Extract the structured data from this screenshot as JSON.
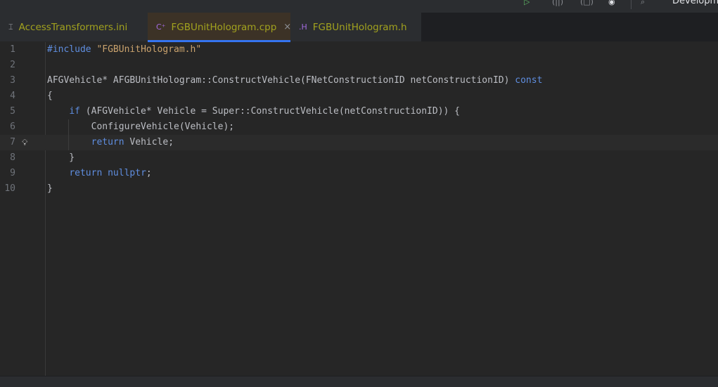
{
  "toolbar": {
    "configuration": "Development",
    "icons": [
      "run-icon",
      "debug-icon",
      "stop-icon",
      "build-icon",
      "search-everywhere-icon"
    ]
  },
  "tabs": [
    {
      "label": "AccessTransformers.ini",
      "icon": "ini-file-icon",
      "icon_glyph": "⌶",
      "active": false
    },
    {
      "label": "FGBUnitHologram.cpp",
      "icon": "cpp-file-icon",
      "icon_glyph": "C⁺",
      "active": true,
      "close": "×"
    },
    {
      "label": "FGBUnitHologram.h",
      "icon": "header-file-icon",
      "icon_glyph": ".H",
      "active": false
    }
  ],
  "editor": {
    "lines": [
      {
        "n": "1",
        "html": "<span class='kw'>#include</span> <span class='str'>\"FGBUnitHologram.h\"</span>"
      },
      {
        "n": "2",
        "html": ""
      },
      {
        "n": "3",
        "html": "AFGVehicle* AFGBUnitHologram::ConstructVehicle(FNetConstructionID netConstructionID) <span class='kw'>const</span>"
      },
      {
        "n": "4",
        "html": "{"
      },
      {
        "n": "5",
        "html": "    <span class='kw'>if</span> (AFGVehicle* Vehicle = Super::ConstructVehicle(netConstructionID)) {"
      },
      {
        "n": "6",
        "html": "        ConfigureVehicle(Vehicle);"
      },
      {
        "n": "7",
        "html": "        <span class='kw'>return</span> Vehicle;"
      },
      {
        "n": "8",
        "html": "    }"
      },
      {
        "n": "9",
        "html": "    <span class='kw'>return</span> <span class='kw'>nullptr</span>;"
      },
      {
        "n": "10",
        "html": "}"
      }
    ],
    "current_line": "7",
    "gutter_icon": "lightbulb-icon"
  },
  "colors": {
    "accent": "#3574f0",
    "keyword": "#5f8ee0",
    "string": "#c9a26d",
    "tab_text": "#a2a21e"
  }
}
